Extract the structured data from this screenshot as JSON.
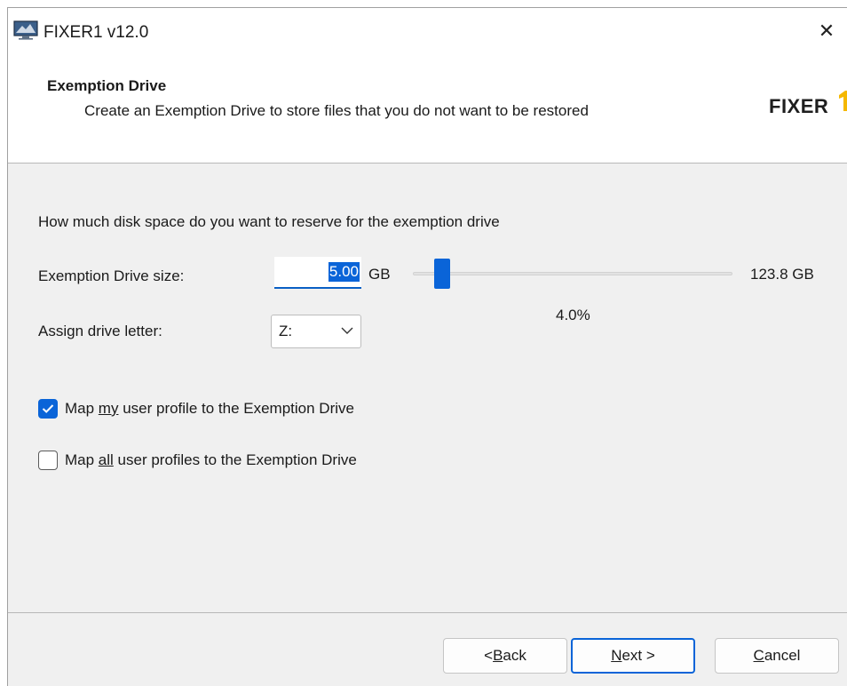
{
  "window": {
    "title": "FIXER1 v12.0",
    "close_glyph": "✕",
    "app_icon": "monitor-icon"
  },
  "header": {
    "title": "Exemption Drive",
    "subtitle": "Create an Exemption Drive to store files that you do not want to be restored",
    "logo_text": "FIXER",
    "logo_mark": "number-one-icon"
  },
  "form": {
    "question": "How much disk space do you want to reserve for the exemption drive",
    "size_label": "Exemption Drive size:",
    "size_value": "5.00",
    "size_unit": "GB",
    "max_size": "123.8 GB",
    "percent": "4.0%",
    "slider_fraction": 0.04,
    "letter_label": "Assign drive letter:",
    "letter_value": "Z:",
    "options": [
      {
        "pre": "Map ",
        "mnemonic": "my",
        "post": " user profile to the Exemption Drive",
        "checked": true
      },
      {
        "pre": "Map ",
        "mnemonic": "all",
        "post": " user profiles to the Exemption Drive",
        "checked": false
      }
    ]
  },
  "buttons": {
    "back": {
      "pre": "< ",
      "mnemonic": "B",
      "post": "ack"
    },
    "next": {
      "pre": "",
      "mnemonic": "N",
      "post": "ext >"
    },
    "cancel": {
      "pre": "",
      "mnemonic": "C",
      "post": "ancel"
    }
  },
  "colors": {
    "accent": "#0a64d8",
    "logo_yellow": "#f5b800"
  }
}
